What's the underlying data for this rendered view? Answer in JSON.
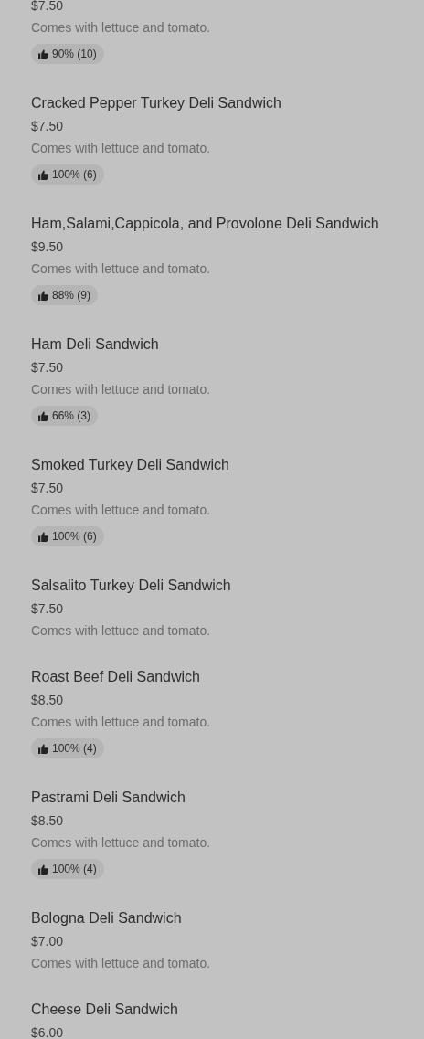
{
  "items": [
    {
      "price": "$7.50",
      "description": "Comes with lettuce and tomato.",
      "rating": "90% (10)"
    },
    {
      "name": "Cracked Pepper Turkey Deli Sandwich",
      "price": "$7.50",
      "description": "Comes with lettuce and tomato.",
      "rating": "100% (6)"
    },
    {
      "name": "Ham,Salami,Cappicola, and Provolone Deli Sandwich",
      "price": "$9.50",
      "description": "Comes with lettuce and tomato.",
      "rating": "88% (9)"
    },
    {
      "name": "Ham Deli Sandwich",
      "price": "$7.50",
      "description": "Comes with lettuce and tomato.",
      "rating": "66% (3)"
    },
    {
      "name": "Smoked Turkey Deli Sandwich",
      "price": "$7.50",
      "description": "Comes with lettuce and tomato.",
      "rating": "100% (6)"
    },
    {
      "name": "Salsalito Turkey Deli Sandwich",
      "price": "$7.50",
      "description": "Comes with lettuce and tomato."
    },
    {
      "name": "Roast Beef Deli Sandwich",
      "price": "$8.50",
      "description": "Comes with lettuce and tomato.",
      "rating": "100% (4)"
    },
    {
      "name": "Pastrami Deli Sandwich",
      "price": "$8.50",
      "description": "Comes with lettuce and tomato.",
      "rating": "100% (4)"
    },
    {
      "name": "Bologna Deli Sandwich",
      "price": "$7.00",
      "description": "Comes with lettuce and tomato."
    },
    {
      "name": "Cheese Deli Sandwich",
      "price": "$6.00"
    }
  ]
}
